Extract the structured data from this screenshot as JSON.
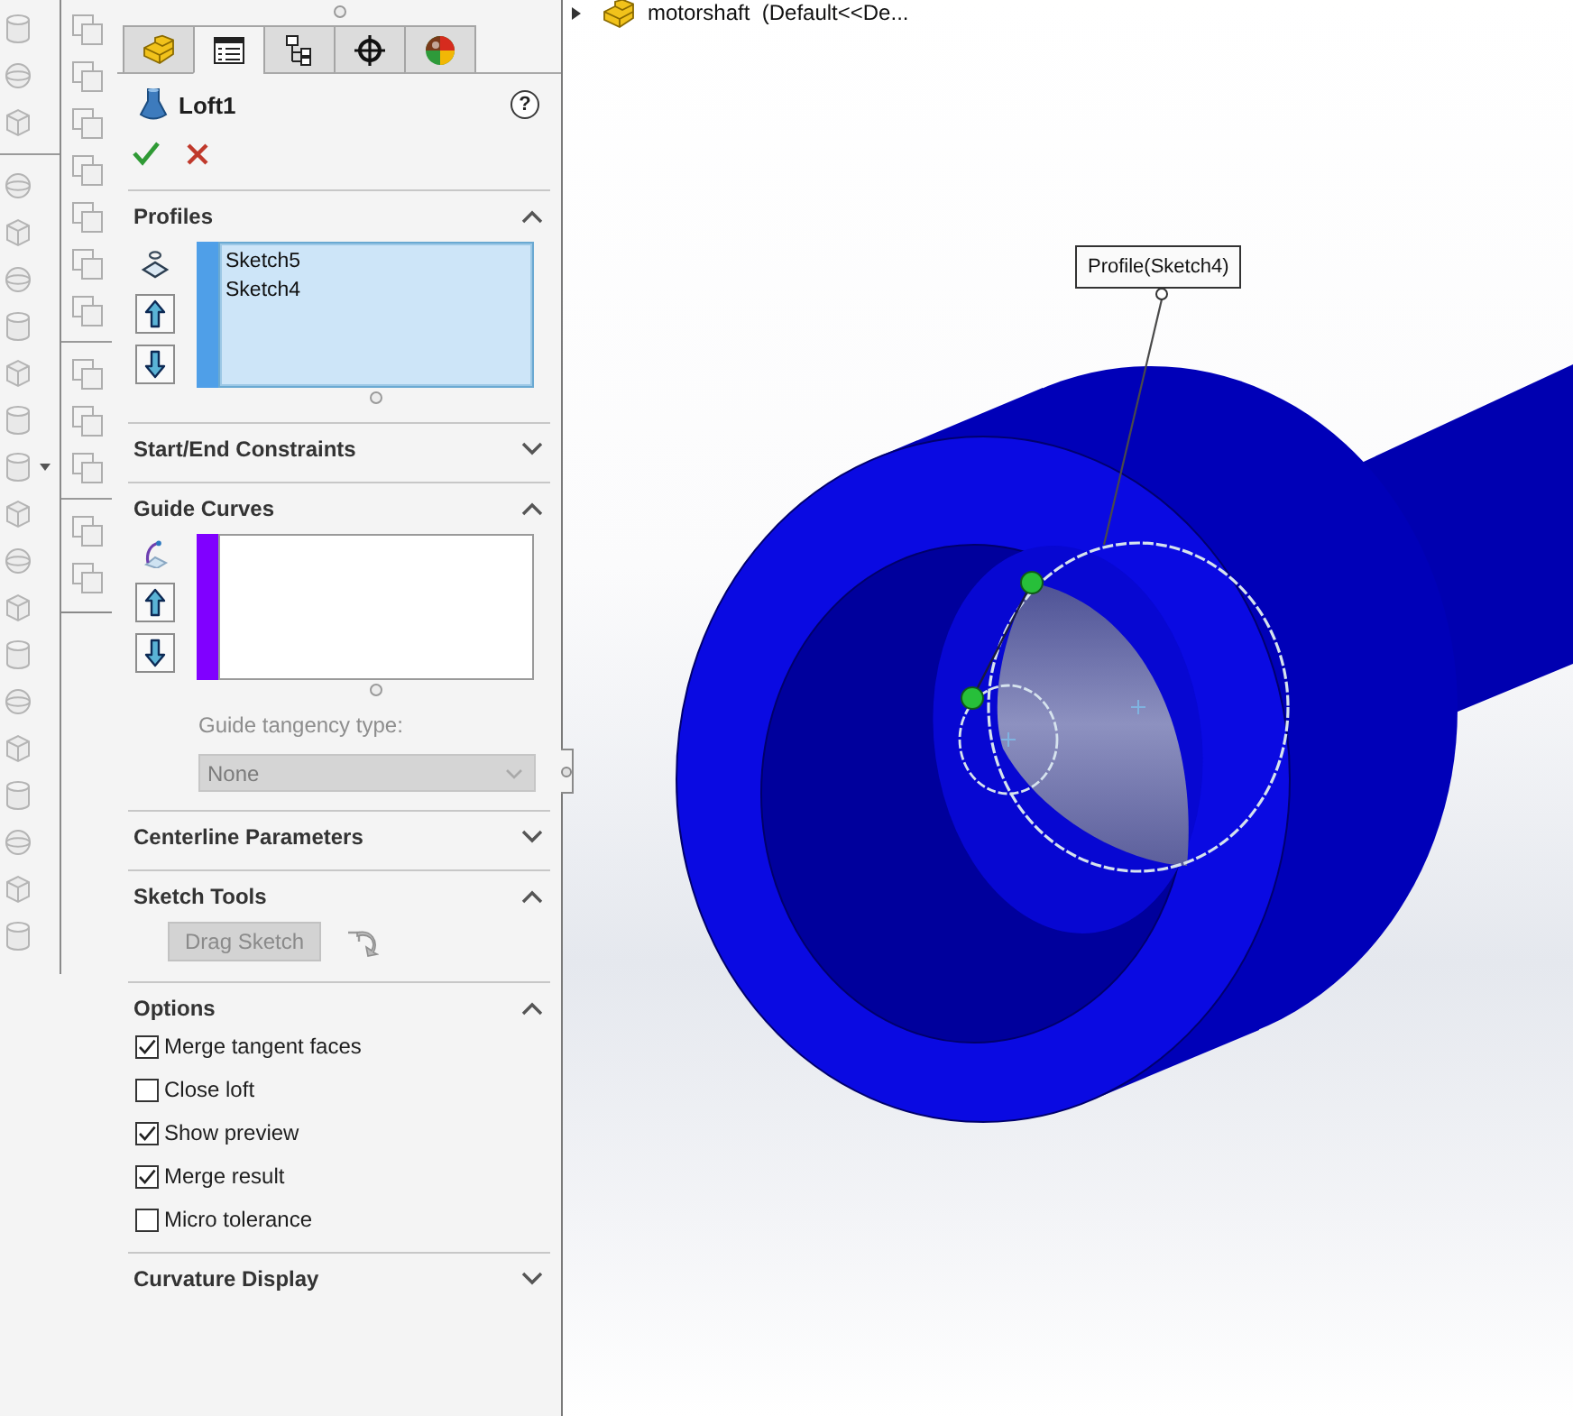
{
  "property_manager": {
    "tabs": [
      {
        "kind": "blocks",
        "selected": false
      },
      {
        "kind": "list",
        "selected": true
      },
      {
        "kind": "tree",
        "selected": false
      },
      {
        "kind": "crosshair",
        "selected": false
      },
      {
        "kind": "sphere",
        "selected": false
      }
    ],
    "title": "Loft1",
    "help": "?",
    "sections": [
      {
        "kind": "profile_list",
        "title": "Profiles",
        "expanded": true,
        "active": true,
        "color": "#4f9fe8",
        "items": [
          "Sketch5",
          "Sketch4"
        ]
      },
      {
        "title": "Start/End Constraints",
        "expanded": false
      },
      {
        "kind": "guide_list",
        "title": "Guide Curves",
        "expanded": true,
        "active": false,
        "color": "#8000ff",
        "tangency_label": "Guide tangency type:",
        "tangency": {
          "value": "None",
          "disabled": true
        }
      },
      {
        "title": "Centerline Parameters",
        "expanded": false
      },
      {
        "kind": "sketch_tools",
        "title": "Sketch Tools",
        "expanded": true,
        "button": {
          "label": "Drag Sketch",
          "disabled": true
        }
      },
      {
        "kind": "options",
        "title": "Options",
        "expanded": true,
        "options": [
          {
            "label": "Merge tangent faces",
            "checked": true
          },
          {
            "label": "Close loft",
            "checked": false
          },
          {
            "label": "Show preview",
            "checked": true
          },
          {
            "label": "Merge result",
            "checked": true
          },
          {
            "label": "Micro tolerance",
            "checked": false
          }
        ]
      },
      {
        "title": "Curvature Display",
        "expanded": false
      }
    ]
  },
  "viewport": {
    "tree_item": {
      "label": "motorshaft  (Default<<De...",
      "expanded": false
    },
    "callout": "Profile(Sketch4)"
  }
}
